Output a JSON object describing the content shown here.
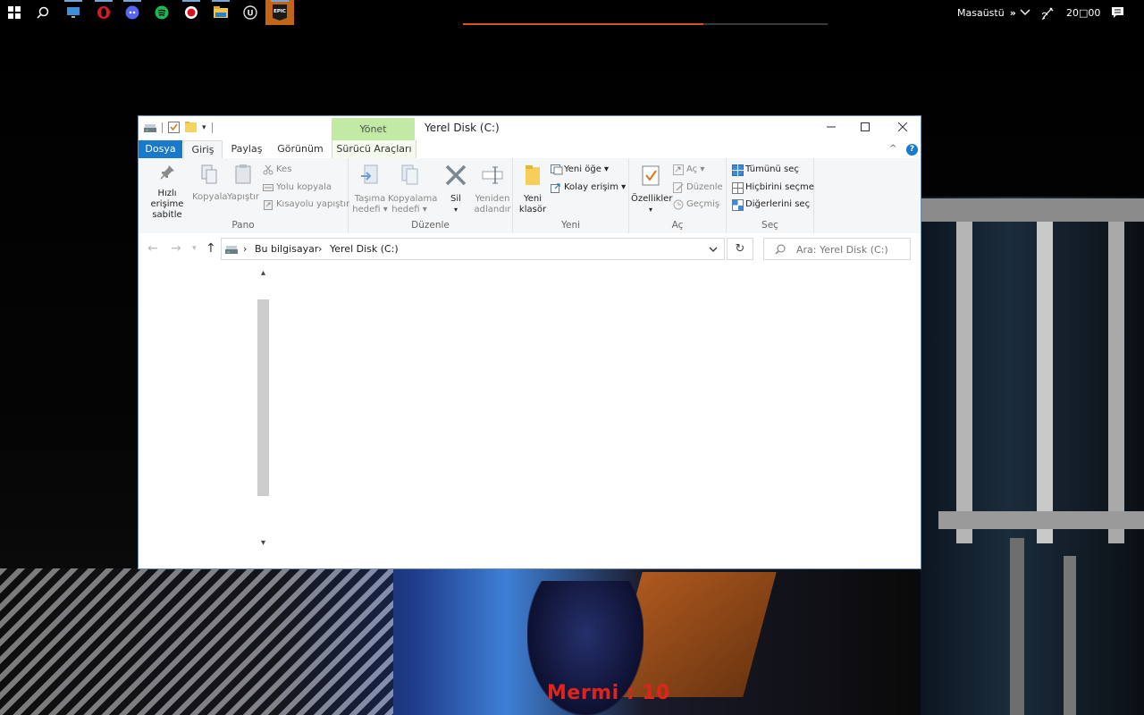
{
  "taskbar": {
    "icons": [
      "windows-start-icon",
      "search-icon",
      "monitor-icon",
      "opera-icon",
      "discord-icon",
      "spotify-icon",
      "record-icon",
      "file-explorer-icon",
      "unreal-engine-icon",
      "epic-games-icon"
    ],
    "desktop_label": "Masaüstü",
    "overflow": "»",
    "clock": "20□00",
    "progress": 0.66
  },
  "window": {
    "title": "Yerel Disk (C:)",
    "manage_tab": "Yönet",
    "tabs": {
      "file": "Dosya",
      "home": "Giriş",
      "share": "Paylaş",
      "view": "Görünüm",
      "drive_tools": "Sürücü Araçları"
    },
    "ribbon": {
      "clipboard": {
        "pin_label_1": "Hızlı erişime",
        "pin_label_2": "sabitle",
        "copy": "Kopyala",
        "paste": "Yapıştır",
        "cut": "Kes",
        "copy_path": "Yolu kopyala",
        "paste_shortcut": "Kısayolu yapıştır",
        "group": "Pano"
      },
      "organize": {
        "move_1": "Taşıma",
        "move_2": "hedefi ▾",
        "copyto_1": "Kopyalama",
        "copyto_2": "hedefi ▾",
        "delete": "Sil",
        "rename_1": "Yeniden",
        "rename_2": "adlandır",
        "group": "Düzenle"
      },
      "new": {
        "folder_1": "Yeni",
        "folder_2": "klasör",
        "new_item": "Yeni öğe ▾",
        "easy_access": "Kolay erişim ▾",
        "group": "Yeni"
      },
      "open": {
        "properties": "Özellikler",
        "open": "Aç ▾",
        "edit": "Düzenle",
        "history": "Geçmiş",
        "group": "Aç"
      },
      "select": {
        "select_all": "Tümünü seç",
        "select_none": "Hiçbirini seçme",
        "invert": "Diğerlerini seç",
        "group": "Seç"
      }
    },
    "address": {
      "crumb1": "Bu bilgisayar",
      "crumb2": "Yerel Disk (C:)"
    },
    "search_placeholder": "Ara: Yerel Disk (C:)"
  },
  "hud": {
    "ammo": "Mermi : 10"
  },
  "colors": {
    "file_tab": "#1979ca",
    "manage_tab": "#c3eaa4",
    "ammo_text": "#e0241b",
    "epic_taskbar_bg": "#c26516"
  }
}
